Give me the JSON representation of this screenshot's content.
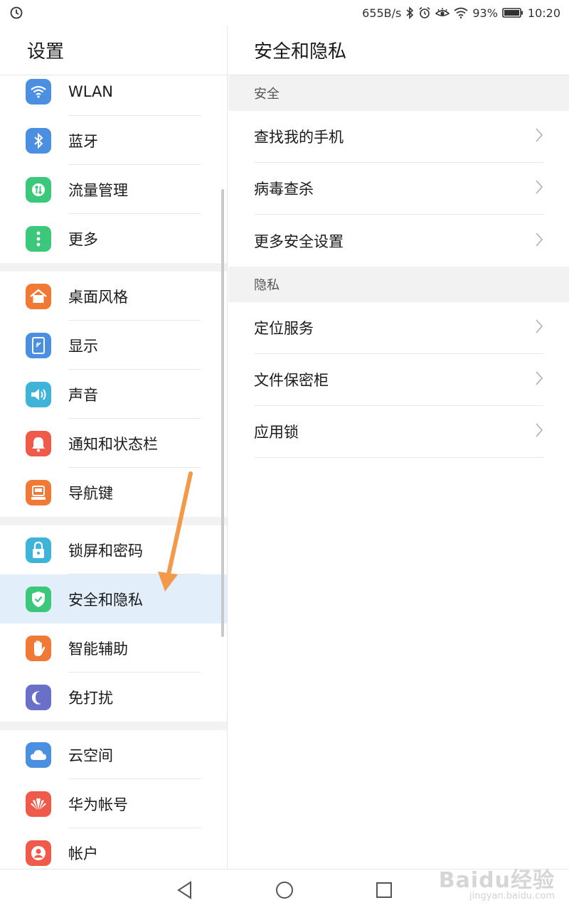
{
  "status_bar": {
    "network_speed": "655B/s",
    "battery_percent": "93%",
    "time": "10:20",
    "icons": [
      "sync-icon",
      "bluetooth-icon",
      "alarm-icon",
      "eye-comfort-icon",
      "wifi-icon",
      "battery-icon"
    ]
  },
  "left_pane": {
    "title": "设置",
    "groups": [
      [
        {
          "label": "WLAN",
          "icon": "wifi-icon",
          "color": "#4a8fe0"
        },
        {
          "label": "蓝牙",
          "icon": "bluetooth-icon",
          "color": "#4a8fe0"
        },
        {
          "label": "流量管理",
          "icon": "data-usage-icon",
          "color": "#3cc87a"
        },
        {
          "label": "更多",
          "icon": "more-icon",
          "color": "#3cc87a"
        }
      ],
      [
        {
          "label": "桌面风格",
          "icon": "home-icon",
          "color": "#f07a35"
        },
        {
          "label": "显示",
          "icon": "display-icon",
          "color": "#4a8fe0"
        },
        {
          "label": "声音",
          "icon": "sound-icon",
          "color": "#3fb4d9"
        },
        {
          "label": "通知和状态栏",
          "icon": "bell-icon",
          "color": "#f05a4a"
        },
        {
          "label": "导航键",
          "icon": "navigation-key-icon",
          "color": "#f07a35"
        }
      ],
      [
        {
          "label": "锁屏和密码",
          "icon": "lock-icon",
          "color": "#3fb4d9"
        },
        {
          "label": "安全和隐私",
          "icon": "shield-icon",
          "color": "#3cc87a",
          "active": true
        },
        {
          "label": "智能辅助",
          "icon": "hand-icon",
          "color": "#f07a35"
        },
        {
          "label": "免打扰",
          "icon": "moon-icon",
          "color": "#6a6fc8"
        }
      ],
      [
        {
          "label": "云空间",
          "icon": "cloud-icon",
          "color": "#4a8fe0"
        },
        {
          "label": "华为帐号",
          "icon": "huawei-icon",
          "color": "#f05a4a"
        },
        {
          "label": "帐户",
          "icon": "account-icon",
          "color": "#f05a4a"
        }
      ]
    ]
  },
  "right_pane": {
    "title": "安全和隐私",
    "sections": [
      {
        "header": "安全",
        "items": [
          "查找我的手机",
          "病毒查杀",
          "更多安全设置"
        ]
      },
      {
        "header": "隐私",
        "items": [
          "定位服务",
          "文件保密柜",
          "应用锁"
        ]
      }
    ]
  },
  "watermark": {
    "main": "Baidu经验",
    "sub": "jingyan.baidu.com"
  },
  "colors": {
    "accent_active": "#e3eefb",
    "annotation_arrow": "#f29a4a"
  }
}
